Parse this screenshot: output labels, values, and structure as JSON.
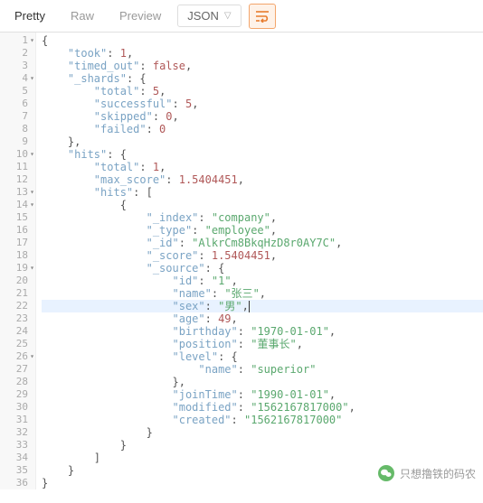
{
  "toolbar": {
    "tabs": {
      "pretty": "Pretty",
      "raw": "Raw",
      "preview": "Preview"
    },
    "format_select": "JSON"
  },
  "gutter": {
    "lines": [
      {
        "n": "1",
        "fold": true
      },
      {
        "n": "2"
      },
      {
        "n": "3"
      },
      {
        "n": "4",
        "fold": true
      },
      {
        "n": "5"
      },
      {
        "n": "6"
      },
      {
        "n": "7"
      },
      {
        "n": "8"
      },
      {
        "n": "9"
      },
      {
        "n": "10",
        "fold": true
      },
      {
        "n": "11"
      },
      {
        "n": "12"
      },
      {
        "n": "13",
        "fold": true
      },
      {
        "n": "14",
        "fold": true
      },
      {
        "n": "15"
      },
      {
        "n": "16"
      },
      {
        "n": "17"
      },
      {
        "n": "18"
      },
      {
        "n": "19",
        "fold": true
      },
      {
        "n": "20"
      },
      {
        "n": "21"
      },
      {
        "n": "22"
      },
      {
        "n": "23"
      },
      {
        "n": "24"
      },
      {
        "n": "25"
      },
      {
        "n": "26",
        "fold": true
      },
      {
        "n": "27"
      },
      {
        "n": "28"
      },
      {
        "n": "29"
      },
      {
        "n": "30"
      },
      {
        "n": "31"
      },
      {
        "n": "32"
      },
      {
        "n": "33"
      },
      {
        "n": "34"
      },
      {
        "n": "35"
      },
      {
        "n": "36"
      }
    ]
  },
  "json_response": {
    "took": 1,
    "timed_out": false,
    "_shards": {
      "total": 5,
      "successful": 5,
      "skipped": 0,
      "failed": 0
    },
    "hits": {
      "total": 1,
      "max_score": 1.5404451,
      "hits": [
        {
          "_index": "company",
          "_type": "employee",
          "_id": "AlkrCm8BkqHzD8r0AY7C",
          "_score": 1.5404451,
          "_source": {
            "id": "1",
            "name": "张三",
            "sex": "男",
            "age": 49,
            "birthday": "1970-01-01",
            "position": "董事长",
            "level": {
              "name": "superior"
            },
            "joinTime": "1990-01-01",
            "modified": "1562167817000",
            "created": "1562167817000"
          }
        }
      ]
    }
  },
  "watermark": {
    "text": "只想撸铁的码农"
  }
}
